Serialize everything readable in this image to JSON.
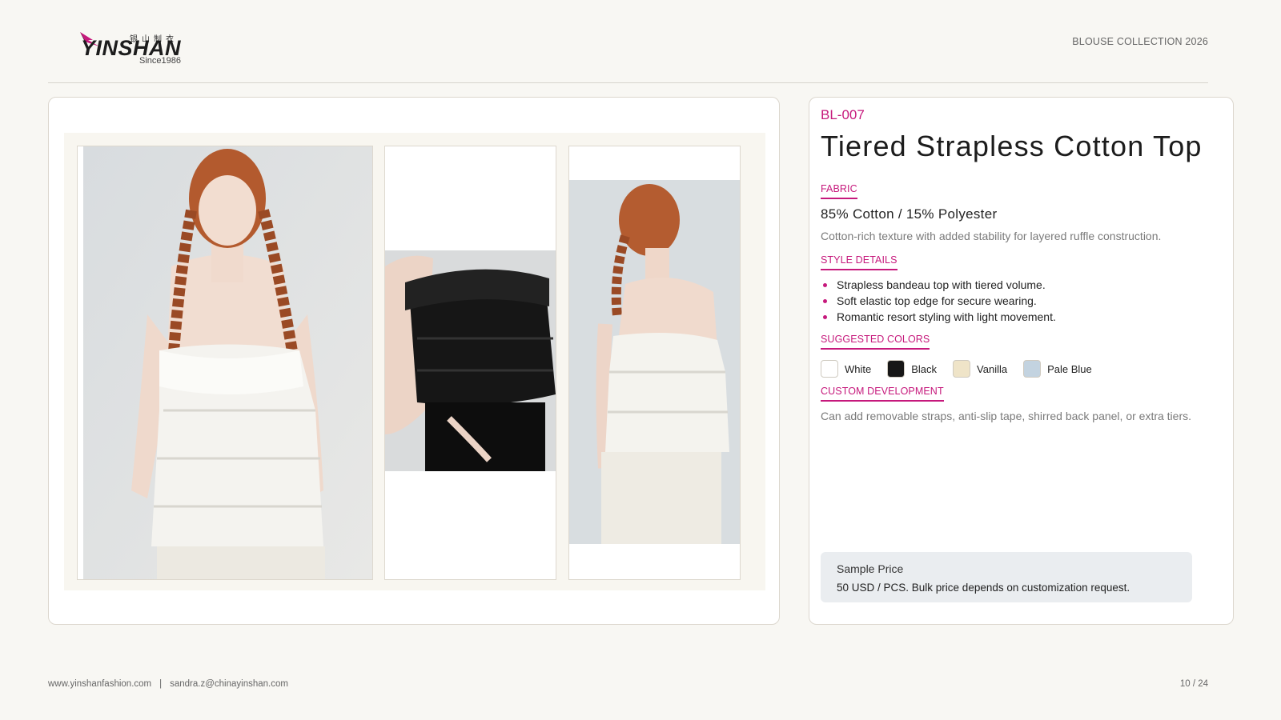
{
  "header": {
    "logo": {
      "chinese": "银山制衣",
      "wordmark": "YINSHAN",
      "since": "Since1986"
    },
    "collection": "BLOUSE COLLECTION 2026"
  },
  "gallery": {
    "photos": [
      {
        "subject": "front view, white tiered strapless top",
        "tone": "white"
      },
      {
        "subject": "side view, black tiered strapless top",
        "tone": "black"
      },
      {
        "subject": "back view, white tiered strapless top",
        "tone": "white"
      }
    ]
  },
  "product": {
    "code": "BL-007",
    "title": "Tiered Strapless Cotton Top",
    "fabric_label": "FABRIC",
    "fabric": "85% Cotton / 15% Polyester",
    "fabric_note": "Cotton-rich texture with added stability for layered ruffle construction.",
    "style_label": "STYLE DETAILS",
    "style_details": [
      "Strapless bandeau top with tiered volume.",
      "Soft elastic top edge for secure wearing.",
      "Romantic resort styling with light movement."
    ],
    "colors_label": "SUGGESTED COLORS",
    "colors": [
      {
        "name": "White",
        "hex": "#ffffff"
      },
      {
        "name": "Black",
        "hex": "#171717"
      },
      {
        "name": "Vanilla",
        "hex": "#efe4c8"
      },
      {
        "name": "Pale Blue",
        "hex": "#c3d3e0"
      }
    ],
    "custom_label": "CUSTOM DEVELOPMENT",
    "custom_note": "Can add removable straps, anti-slip tape, shirred back panel, or extra tiers.",
    "price_title": "Sample Price",
    "price_text": "50 USD / PCS. Bulk price depends on customization request."
  },
  "footer": {
    "website": "www.yinshanfashion.com",
    "separator": "|",
    "email": "sandra.z@chinayinshan.com",
    "page": "10 / 24"
  },
  "colors": {
    "accent": "#c6197c",
    "background": "#f8f7f3",
    "card_border": "#dcd7ce",
    "price_box": "#eaedf0"
  }
}
